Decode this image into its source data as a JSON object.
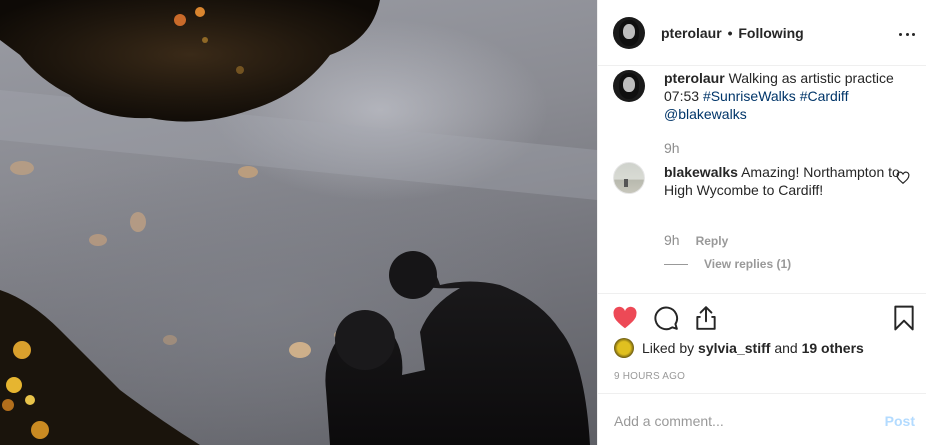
{
  "header": {
    "username": "pterolaur",
    "separator": "•",
    "follow_status": "Following",
    "more_icon": "more-horizontal-icon"
  },
  "caption": {
    "username": "pterolaur",
    "text_before": "Walking as artistic practice 07:53",
    "hashtag1": "#SunriseWalks",
    "hashtag2": "#Cardiff",
    "mention": "@blakewalks",
    "time": "9h"
  },
  "comment": {
    "username": "blakewalks",
    "text": "Amazing! Northampton to High Wycombe to Cardiff!",
    "time": "9h",
    "reply_label": "Reply",
    "view_replies_label": "View replies (1)"
  },
  "actions": {
    "like_icon": "heart-filled-icon",
    "like_color": "#ed4956",
    "comment_icon": "comment-bubble-icon",
    "share_icon": "share-icon",
    "save_icon": "bookmark-icon"
  },
  "likes": {
    "prefix": "Liked by",
    "liker": "sylvia_stiff",
    "conj": "and",
    "others": "19 others"
  },
  "post_time": "9 HOURS AGO",
  "add_comment": {
    "placeholder": "Add a comment...",
    "post_label": "Post",
    "post_color": "#b3dbff"
  }
}
